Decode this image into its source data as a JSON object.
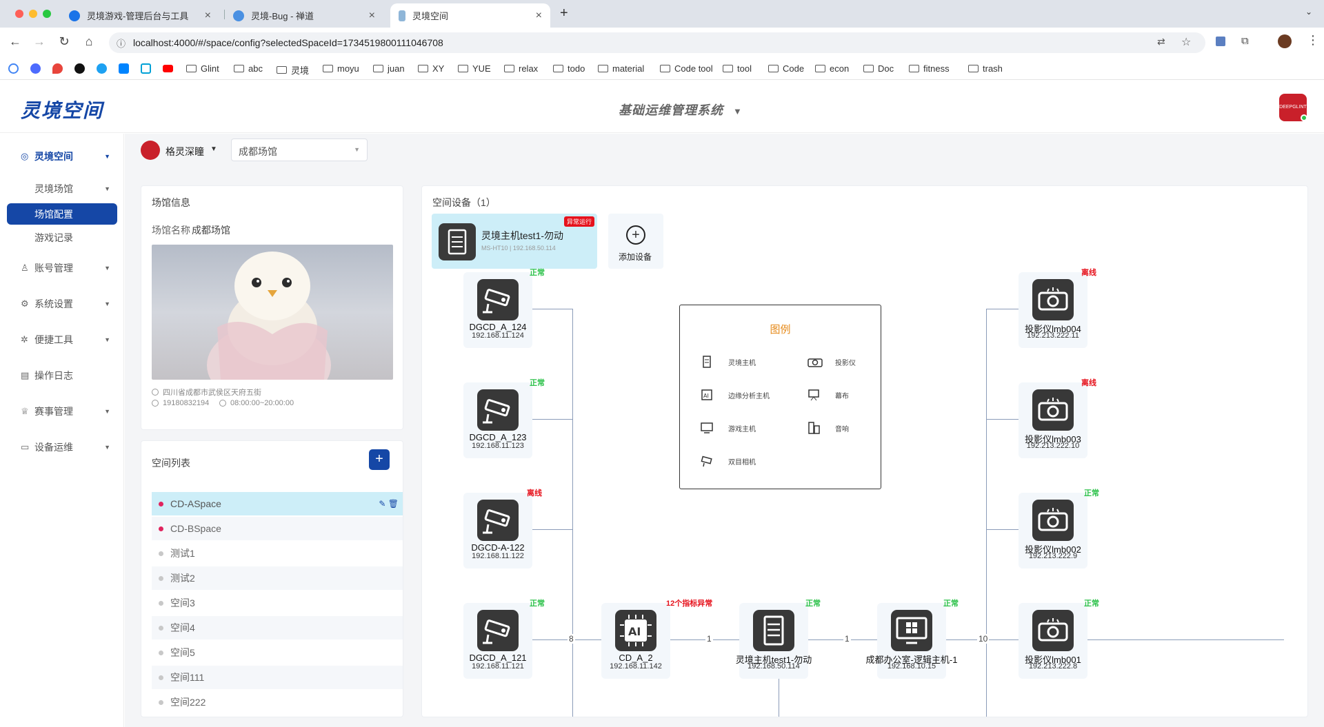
{
  "browser": {
    "tabs": [
      {
        "title": "灵境游戏-管理后台与工具",
        "active": false
      },
      {
        "title": "灵境-Bug - 禅道",
        "active": false
      },
      {
        "title": "灵境空间",
        "active": true
      }
    ],
    "new_tab": "+",
    "url": "localhost:4000/#/space/config?selectedSpaceId=1734519800111046708",
    "bookmarks": [
      "Glint",
      "abc",
      "灵境",
      "moyu",
      "juan",
      "XY",
      "YUE",
      "relax",
      "todo",
      "material",
      "Code tool",
      "tool",
      "Code",
      "econ",
      "Doc",
      "fitness",
      "trash"
    ]
  },
  "app": {
    "logo": "灵境空间",
    "system_title": "基础运维管理系统",
    "avatar_text": "DEEPGLINT"
  },
  "sidebar": {
    "items": [
      {
        "label": "灵境空间",
        "icon": "globe-icon"
      },
      {
        "label": "灵境场馆"
      },
      {
        "label": "场馆配置"
      },
      {
        "label": "游戏记录"
      },
      {
        "label": "账号管理",
        "icon": "user-icon"
      },
      {
        "label": "系统设置",
        "icon": "gear-icon"
      },
      {
        "label": "便捷工具",
        "icon": "tool-icon"
      },
      {
        "label": "操作日志",
        "icon": "document-icon"
      },
      {
        "label": "赛事管理",
        "icon": "trophy-icon"
      },
      {
        "label": "设备运维",
        "icon": "monitor-icon"
      }
    ]
  },
  "toolbar": {
    "org_name": "格灵深瞳",
    "venue_select": "成都场馆"
  },
  "venue_info": {
    "title": "场馆信息",
    "name_label": "场馆名称",
    "name_value": "成都场馆",
    "address": "四川省成都市武侯区天府五街",
    "phone": "19180832194",
    "hours": "08:00:00~20:00:00"
  },
  "space_list": {
    "title": "空间列表",
    "add_label": "+",
    "items": [
      {
        "name": "CD-ASpace",
        "dot": "#e0245e"
      },
      {
        "name": "CD-BSpace",
        "dot": "#e0245e"
      },
      {
        "name": "测试1",
        "dot": "#c8c8c8"
      },
      {
        "name": "测试2",
        "dot": "#c8c8c8"
      },
      {
        "name": "空间3",
        "dot": "#c8c8c8"
      },
      {
        "name": "空间4",
        "dot": "#c8c8c8"
      },
      {
        "name": "空间5",
        "dot": "#c8c8c8"
      },
      {
        "name": "空间111",
        "dot": "#c8c8c8"
      },
      {
        "name": "空间222",
        "dot": "#c8c8c8"
      }
    ]
  },
  "devices": {
    "title": "空间设备（1）",
    "host": {
      "name": "灵境主机test1-勿动",
      "model": "MS-HT10",
      "ip": "192.168.50.114",
      "badge": "异常运行"
    },
    "add_label": "添加设备",
    "nodes": [
      {
        "name": "DGCD_A_124",
        "ip": "192.168.11.124",
        "status": "正常",
        "type": "camera-icon"
      },
      {
        "name": "DGCD_A_123",
        "ip": "192.168.11.123",
        "status": "正常",
        "type": "camera-icon"
      },
      {
        "name": "DGCD-A-122",
        "ip": "192.168.11.122",
        "status": "离线",
        "type": "camera-icon"
      },
      {
        "name": "DGCD_A_121",
        "ip": "192.168.11.121",
        "status": "正常",
        "type": "camera-icon"
      },
      {
        "name": "CD_A_2",
        "ip": "192.168.11.142",
        "status": "12个指标异常",
        "type": "ai-chip-icon"
      },
      {
        "name": "灵境主机test1-勿动",
        "ip": "192.168.50.114",
        "status": "正常",
        "type": "server-icon"
      },
      {
        "name": "成都办公室-逻辑主机-1",
        "ip": "192.168.10.15",
        "status": "正常",
        "type": "windows-pc-icon"
      },
      {
        "name": "投影仪lmb004",
        "ip": "192.213.222.11",
        "status": "离线",
        "type": "projector-icon"
      },
      {
        "name": "投影仪lmb003",
        "ip": "192.213.222.10",
        "status": "离线",
        "type": "projector-icon"
      },
      {
        "name": "投影仪lmb002",
        "ip": "192.213.222.9",
        "status": "正常",
        "type": "projector-icon"
      },
      {
        "name": "投影仪lmb001",
        "ip": "192.213.222.8",
        "status": "正常",
        "type": "projector-icon"
      }
    ],
    "edge_labels": [
      "8",
      "1",
      "1",
      "10"
    ],
    "legend": {
      "title": "图例",
      "items": [
        "灵境主机",
        "投影仪",
        "边缘分析主机",
        "幕布",
        "游戏主机",
        "音响",
        "双目相机"
      ]
    }
  },
  "colors": {
    "brand": "#1547a6",
    "ok": "#2ec24b",
    "bad": "#e6121c",
    "highlight": "#cdeef8"
  }
}
